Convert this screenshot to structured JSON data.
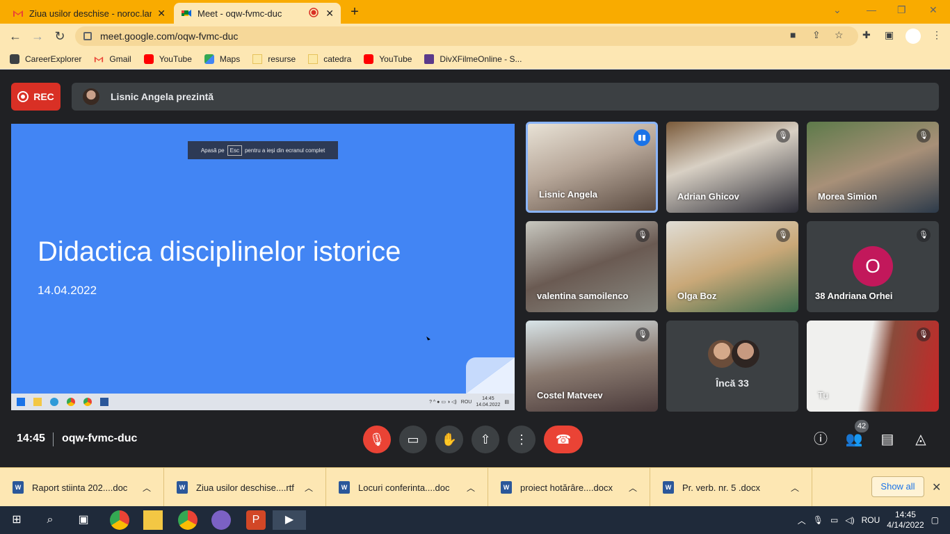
{
  "browser": {
    "tabs": [
      {
        "title": "Ziua usilor deschise - noroc.larisa",
        "icon": "gmail-icon"
      },
      {
        "title": "Meet - oqw-fvmc-duc",
        "icon": "meet-icon",
        "recording": true
      }
    ],
    "new_tab": "+",
    "url": "meet.google.com/oqw-fvmc-duc",
    "bookmarks": [
      "CareerExplorer",
      "Gmail",
      "YouTube",
      "Maps",
      "resurse",
      "catedra",
      "YouTube",
      "DivXFilmeOnline - S..."
    ]
  },
  "meet": {
    "rec_label": "REC",
    "presenter_text": "Lisnic Angela prezintă",
    "slide": {
      "esc_prefix": "Apasă pe",
      "esc_key": "Esc",
      "esc_suffix": "pentru a ieși din ecranul complet",
      "title": "Didactica disciplinelor istorice",
      "date": "14.04.2022",
      "taskbar_time": "14:45",
      "taskbar_date": "14.04.2022",
      "taskbar_lang": "ROU"
    },
    "participants": [
      {
        "name": "Lisnic Angela",
        "speaking": true
      },
      {
        "name": "Adrian Ghicov"
      },
      {
        "name": "Morea Simion"
      },
      {
        "name": "valentina samoilenco"
      },
      {
        "name": "Olga Boz"
      },
      {
        "name": "38 Andriana Orhei",
        "initial": "O"
      },
      {
        "name": "Costel Matveev"
      },
      {
        "name": "Încă 33"
      },
      {
        "name": "Tu"
      }
    ],
    "time": "14:45",
    "code": "oqw-fvmc-duc",
    "participant_count": "42"
  },
  "downloads": {
    "items": [
      "Raport stiinta 202....doc",
      "Ziua usilor deschise....rtf",
      "Locuri  conferinta....doc",
      "proiect hotărâre....docx",
      "Pr. verb. nr. 5 .docx"
    ],
    "show_all": "Show all"
  },
  "taskbar": {
    "lang": "ROU",
    "time": "14:45",
    "date": "4/14/2022"
  },
  "colors": {
    "tab_bar": "#f9ab00",
    "toolbar": "#fde7b3",
    "slide": "#4285f4",
    "mute_red": "#ea4335",
    "avatar_pink": "#c2185b"
  }
}
